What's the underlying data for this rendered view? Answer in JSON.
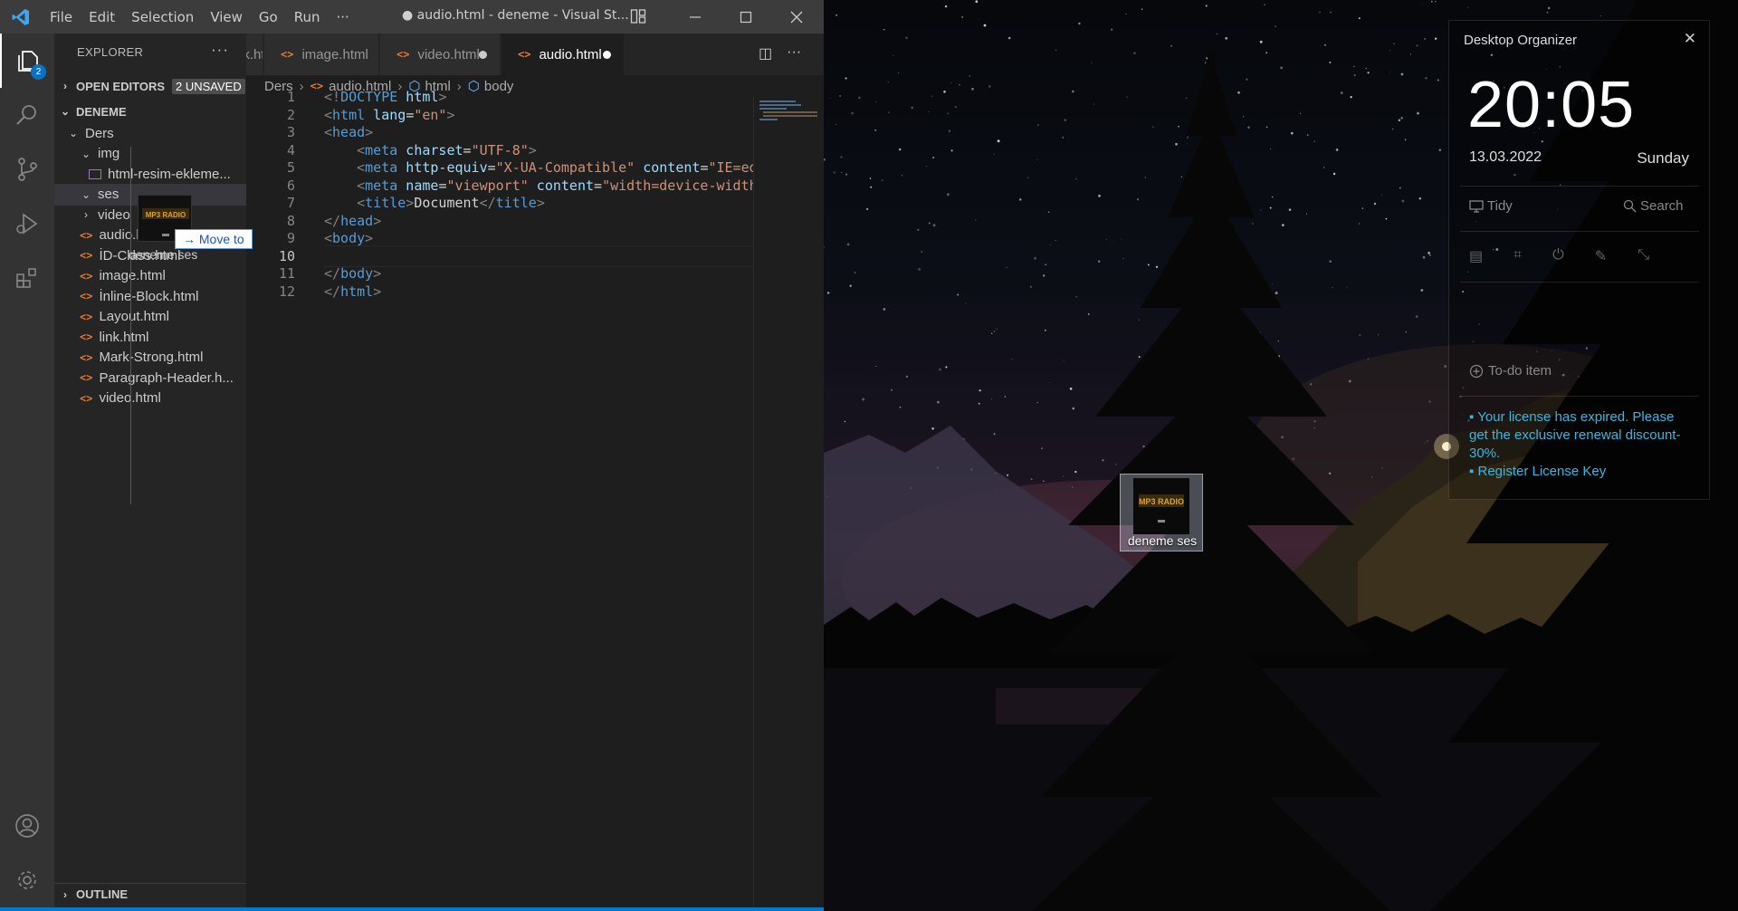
{
  "window": {
    "title": "● audio.html - deneme - Visual St...",
    "menu": [
      "File",
      "Edit",
      "Selection",
      "View",
      "Go",
      "Run",
      "···"
    ]
  },
  "activity": {
    "explorer_badge": "2"
  },
  "explorer": {
    "title": "EXPLORER",
    "more": "···",
    "open_editors_label": "OPEN EDITORS",
    "unsaved_label": "2 UNSAVED",
    "workspace": "DENEME",
    "outline_label": "OUTLINE",
    "tree": [
      {
        "label": "Ders",
        "type": "folder",
        "expanded": true
      },
      {
        "label": "img",
        "type": "folder",
        "expanded": true
      },
      {
        "label": "html-resim-ekleme...",
        "type": "image"
      },
      {
        "label": "ses",
        "type": "folder",
        "expanded": true
      },
      {
        "label": "video",
        "type": "folder",
        "expanded": false
      },
      {
        "label": "audio.html",
        "type": "html"
      },
      {
        "label": "İD-Class.html",
        "type": "html"
      },
      {
        "label": "image.html",
        "type": "html"
      },
      {
        "label": "İnline-Block.html",
        "type": "html"
      },
      {
        "label": "Layout.html",
        "type": "html"
      },
      {
        "label": "link.html",
        "type": "html"
      },
      {
        "label": "Mark-Strong.html",
        "type": "html"
      },
      {
        "label": "Paragraph-Header.h...",
        "type": "html"
      },
      {
        "label": "video.html",
        "type": "html"
      }
    ],
    "drag": {
      "tooltip": "Move to",
      "label": "deneme ses"
    }
  },
  "tabs": [
    {
      "label": "nk.html",
      "dirty": false,
      "active": false
    },
    {
      "label": "image.html",
      "dirty": false,
      "active": false
    },
    {
      "label": "video.html",
      "dirty": true,
      "active": false
    },
    {
      "label": "audio.html",
      "dirty": true,
      "active": true
    }
  ],
  "breadcrumb": [
    "Ders",
    "audio.html",
    "html",
    "body"
  ],
  "editor": {
    "current_line": 10,
    "lines": [
      {
        "n": "1",
        "code": [
          [
            "#808080",
            "<!"
          ],
          [
            "#569cd6",
            "DOCTYPE"
          ],
          [
            "#9cdcfe",
            " html"
          ],
          [
            "#808080",
            ">"
          ]
        ]
      },
      {
        "n": "2",
        "code": [
          [
            "#808080",
            "<"
          ],
          [
            "#569cd6",
            "html"
          ],
          [
            "#9cdcfe",
            " lang"
          ],
          [
            "#d4d4d4",
            "="
          ],
          [
            "#ce9178",
            "\"en\""
          ],
          [
            "#808080",
            ">"
          ]
        ]
      },
      {
        "n": "3",
        "code": [
          [
            "#808080",
            "<"
          ],
          [
            "#569cd6",
            "head"
          ],
          [
            "#808080",
            ">"
          ]
        ]
      },
      {
        "n": "4",
        "code": [
          [
            "#d4d4d4",
            "    "
          ],
          [
            "#808080",
            "<"
          ],
          [
            "#569cd6",
            "meta"
          ],
          [
            "#9cdcfe",
            " charset"
          ],
          [
            "#d4d4d4",
            "="
          ],
          [
            "#ce9178",
            "\"UTF-8\""
          ],
          [
            "#808080",
            ">"
          ]
        ]
      },
      {
        "n": "5",
        "code": [
          [
            "#d4d4d4",
            "    "
          ],
          [
            "#808080",
            "<"
          ],
          [
            "#569cd6",
            "meta"
          ],
          [
            "#9cdcfe",
            " http-equiv"
          ],
          [
            "#d4d4d4",
            "="
          ],
          [
            "#ce9178",
            "\"X-UA-Compatible\""
          ],
          [
            "#9cdcfe",
            " content"
          ],
          [
            "#d4d4d4",
            "="
          ],
          [
            "#ce9178",
            "\"IE=edge\""
          ],
          [
            "#808080",
            ">"
          ]
        ]
      },
      {
        "n": "6",
        "code": [
          [
            "#d4d4d4",
            "    "
          ],
          [
            "#808080",
            "<"
          ],
          [
            "#569cd6",
            "meta"
          ],
          [
            "#9cdcfe",
            " name"
          ],
          [
            "#d4d4d4",
            "="
          ],
          [
            "#ce9178",
            "\"viewport\""
          ],
          [
            "#9cdcfe",
            " content"
          ],
          [
            "#d4d4d4",
            "="
          ],
          [
            "#ce9178",
            "\"width=device-width\""
          ],
          [
            "#808080",
            ">"
          ]
        ]
      },
      {
        "n": "7",
        "code": [
          [
            "#d4d4d4",
            "    "
          ],
          [
            "#808080",
            "<"
          ],
          [
            "#569cd6",
            "title"
          ],
          [
            "#808080",
            ">"
          ],
          [
            "#d4d4d4",
            "Document"
          ],
          [
            "#808080",
            "</"
          ],
          [
            "#569cd6",
            "title"
          ],
          [
            "#808080",
            ">"
          ]
        ]
      },
      {
        "n": "8",
        "code": [
          [
            "#808080",
            "</"
          ],
          [
            "#569cd6",
            "head"
          ],
          [
            "#808080",
            ">"
          ]
        ]
      },
      {
        "n": "9",
        "code": [
          [
            "#808080",
            "<"
          ],
          [
            "#569cd6",
            "body"
          ],
          [
            "#808080",
            ">"
          ]
        ]
      },
      {
        "n": "10",
        "code": []
      },
      {
        "n": "11",
        "code": [
          [
            "#808080",
            "</"
          ],
          [
            "#569cd6",
            "body"
          ],
          [
            "#808080",
            ">"
          ]
        ]
      },
      {
        "n": "12",
        "code": [
          [
            "#808080",
            "</"
          ],
          [
            "#569cd6",
            "html"
          ],
          [
            "#808080",
            ">"
          ]
        ]
      }
    ]
  },
  "desktop": {
    "icon_label": "deneme ses"
  },
  "organizer": {
    "title": "Desktop Organizer",
    "close": "✕",
    "time": "20:05",
    "date": "13.03.2022",
    "day": "Sunday",
    "tidy_label": "Tidy",
    "search_label": "Search",
    "todo_label": "To-do item",
    "license_line1": "▪ Your license has expired. Please get the exclusive renewal discount-30%.",
    "license_line2": "▪ Register License Key"
  },
  "colors": {
    "accent": "#007acc",
    "link": "#38b7e0",
    "html_icon": "#e37933"
  }
}
